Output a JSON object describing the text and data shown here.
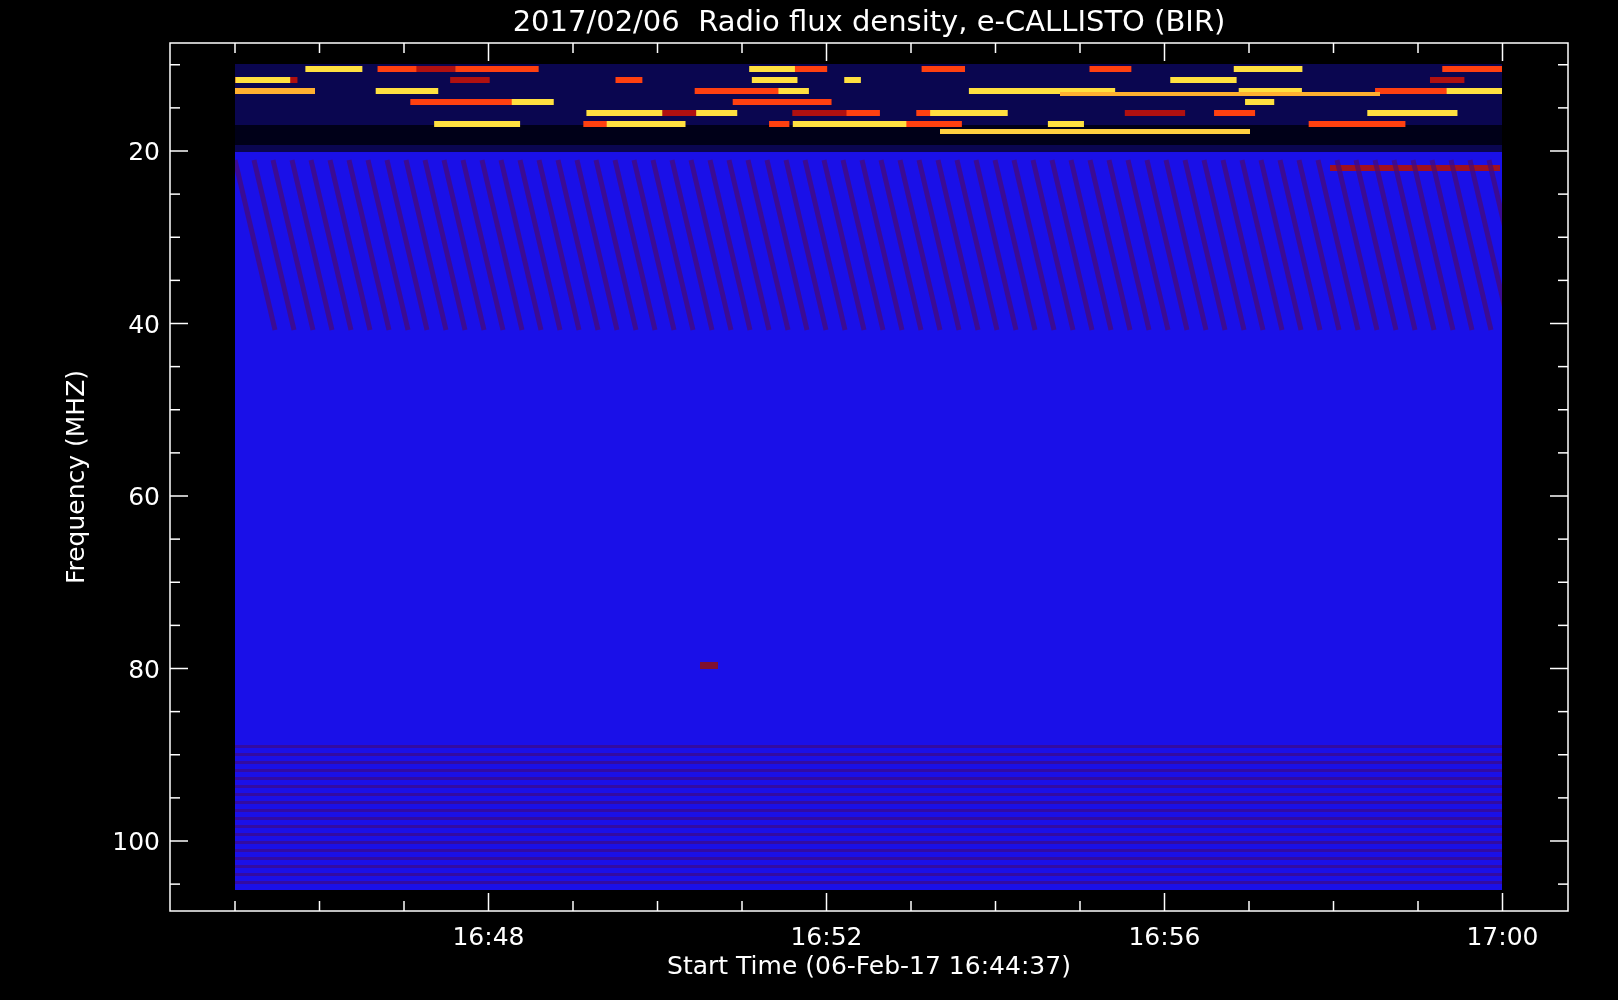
{
  "plot": {
    "title": "2017/02/06  Radio flux density, e-CALLISTO (BIR)",
    "ylabel": "Frequency (MHZ)",
    "xlabel": "Start Time (06-Feb-17 16:44:37)",
    "yticks": [
      "20",
      "40",
      "60",
      "80",
      "100"
    ],
    "xticks": [
      "16:48",
      "16:52",
      "16:56",
      "17:00"
    ]
  }
}
